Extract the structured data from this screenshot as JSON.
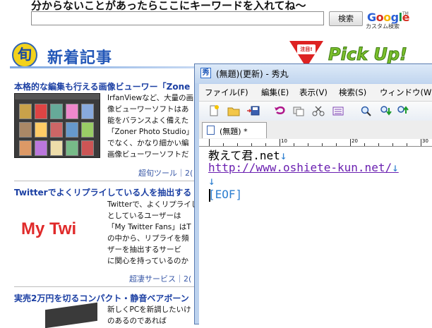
{
  "webpage": {
    "search": {
      "prompt": "分からないことがあったらここにキーワードを入れてね～",
      "input_value": "",
      "button_label": "検索",
      "google_logo": [
        "G",
        "o",
        "o",
        "g",
        "l",
        "e"
      ],
      "google_tm": "TM",
      "google_sub": "カスタム検索"
    },
    "new_articles": {
      "icon_char": "旬",
      "heading": "新着記事"
    },
    "pickup": {
      "badge": "注目!",
      "label": "Pick Up!"
    },
    "articles": [
      {
        "title": "本格的な編集も行える画像ビューワー「Zone",
        "body": [
          "IrfanViewなど、大量の画",
          "像ビューワーソフトはあ",
          "能をバランスよく備えた",
          "「Zoner Photo Studio」",
          "でなく、かなり細かい編",
          "画像ビューワーソフトだ"
        ],
        "footer": "超旬ツール｜2("
      },
      {
        "title": "Twitterでよくリプライしている人を抽出する",
        "thumb_text": "My Twi",
        "body": [
          "Twitterで、よくリプライし",
          "としているユーザーは",
          "「My Twitter Fans」はT",
          "の中から、リプライを頻",
          "ザーを抽出するサービ",
          "に関心を持っているのか"
        ],
        "footer": "超凄サービス｜2("
      },
      {
        "title": "実売2万円を切るコンパクト・静音ベアボーン",
        "body": [
          "新しくPCを新調したいけ",
          "のあるのであれば"
        ],
        "footer": ""
      }
    ]
  },
  "editor": {
    "title": "(無題)(更新) - 秀丸",
    "app_icon_char": "秀",
    "menu": [
      "ファイル(F)",
      "編集(E)",
      "表示(V)",
      "検索(S)",
      "ウィンドウ(W"
    ],
    "toolbar_icons": [
      "new-file-icon",
      "open-folder-icon",
      "save-icon",
      "undo-icon",
      "copy-icon",
      "cut-icon",
      "paste-icon",
      "search-icon",
      "search-down-icon",
      "search-next-icon"
    ],
    "tab_label": "(無題) *",
    "ruler_labels": [
      "10",
      "20",
      "30"
    ],
    "lines": [
      {
        "text": "教えて君.net",
        "eol": "↓",
        "color": "#000000"
      },
      {
        "text": "http://www.oshiete-kun.net/",
        "eol": "↓",
        "color": "#6a1fb0"
      },
      {
        "text": "",
        "eol": "↓",
        "color": "#000000"
      },
      {
        "text": "[EOF]",
        "eol": "",
        "color": "#2d7fd0"
      }
    ]
  }
}
